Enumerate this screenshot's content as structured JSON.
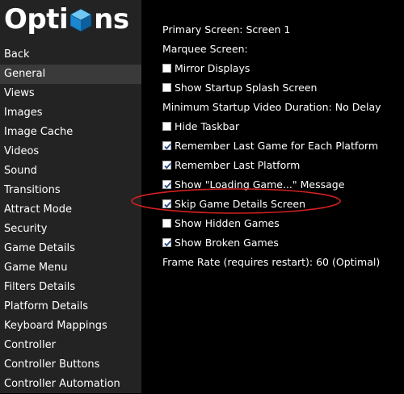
{
  "header": {
    "title_left": "Opti",
    "title_right": "ns",
    "logo_icon": "blue-cube-icon"
  },
  "sidebar": {
    "items": [
      {
        "label": "Back"
      },
      {
        "label": "General",
        "selected": true
      },
      {
        "label": "Views"
      },
      {
        "label": "Images"
      },
      {
        "label": "Image Cache"
      },
      {
        "label": "Videos"
      },
      {
        "label": "Sound"
      },
      {
        "label": "Transitions"
      },
      {
        "label": "Attract Mode"
      },
      {
        "label": "Security"
      },
      {
        "label": "Game Details"
      },
      {
        "label": "Game Menu"
      },
      {
        "label": "Filters Details"
      },
      {
        "label": "Platform Details"
      },
      {
        "label": "Keyboard Mappings"
      },
      {
        "label": "Controller"
      },
      {
        "label": "Controller Buttons"
      },
      {
        "label": "Controller Automation"
      }
    ]
  },
  "settings": {
    "primary_screen": {
      "label": "Primary Screen:",
      "value": "Screen 1"
    },
    "marquee_screen": {
      "label": "Marquee Screen:",
      "value": ""
    },
    "mirror_displays": {
      "label": "Mirror Displays",
      "checked": false
    },
    "show_startup_splash": {
      "label": "Show Startup Splash Screen",
      "checked": false
    },
    "min_startup_video": {
      "label": "Minimum Startup Video Duration:",
      "value": "No Delay"
    },
    "hide_taskbar": {
      "label": "Hide Taskbar",
      "checked": false
    },
    "remember_last_game": {
      "label": "Remember Last Game for Each Platform",
      "checked": true
    },
    "remember_last_platform": {
      "label": "Remember Last Platform",
      "checked": true
    },
    "show_loading_message": {
      "label": "Show \"Loading Game...\" Message",
      "checked": true
    },
    "skip_game_details": {
      "label": "Skip Game Details Screen",
      "checked": true
    },
    "show_hidden_games": {
      "label": "Show Hidden Games",
      "checked": false
    },
    "show_broken_games": {
      "label": "Show Broken Games",
      "checked": true
    },
    "frame_rate": {
      "label": "Frame Rate (requires restart):",
      "value": "60 (Optimal)"
    }
  },
  "colors": {
    "sidebar_bg": "#232323",
    "selected_bg": "#3a3a3a",
    "content_bg": "#000000",
    "highlight_ellipse": "#d42020",
    "checkmark": "#2a4a8a"
  }
}
